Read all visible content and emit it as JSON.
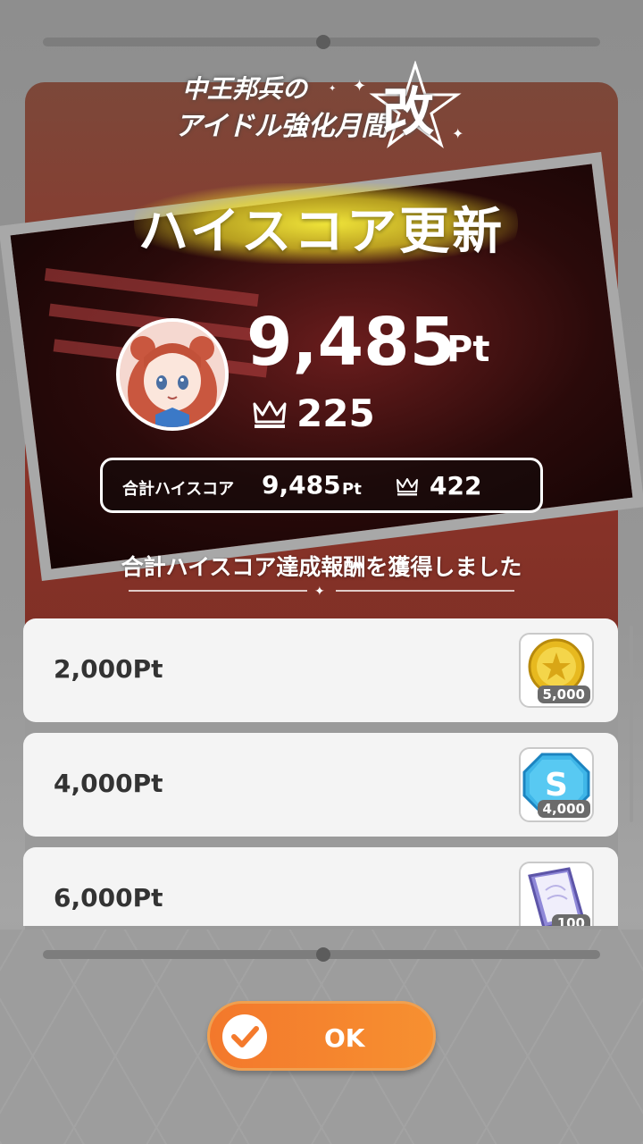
{
  "event_logo": {
    "line1": "中王邦兵の",
    "line2": "アイドル強化月間",
    "badge": "改"
  },
  "header": {
    "title": "ハイスコア更新"
  },
  "score": {
    "value": "9,485",
    "unit": "Pt",
    "rank": "225"
  },
  "total": {
    "label": "合計ハイスコア",
    "value": "9,485",
    "unit": "Pt",
    "rank": "422"
  },
  "rewards": {
    "heading": "合計ハイスコア達成報酬を獲得しました",
    "items": [
      {
        "threshold": "2,000Pt",
        "icon": "gold-coin-icon",
        "quantity": "5,000"
      },
      {
        "threshold": "4,000Pt",
        "icon": "blue-s-gem-icon",
        "quantity": "4,000"
      },
      {
        "threshold": "6,000Pt",
        "icon": "purple-book-icon",
        "quantity": "100"
      }
    ]
  },
  "actions": {
    "ok_label": "OK"
  },
  "colors": {
    "ok_button": "#f47a2c",
    "title_glow": "#f4e23a",
    "dim_overlay": "#8f8f8f"
  }
}
